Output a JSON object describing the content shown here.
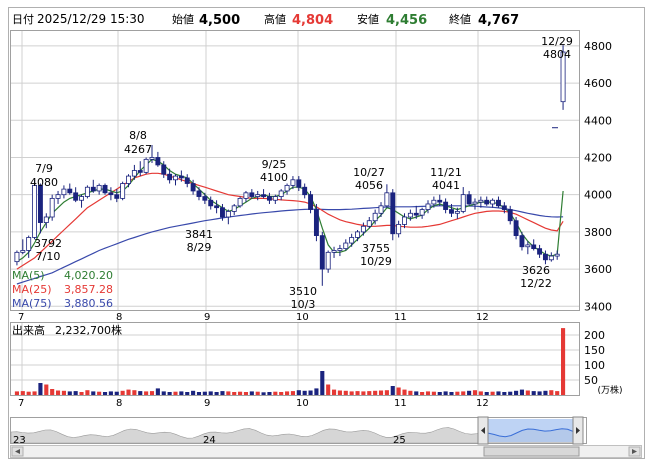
{
  "header": {
    "date_label": "日付",
    "datetime": "2025/12/29 15:30",
    "open_label": "始値",
    "open_value": "4,500",
    "high_label": "高値",
    "high_value": "4,804",
    "low_label": "安値",
    "low_value": "4,456",
    "close_label": "終値",
    "close_value": "4,767"
  },
  "price_axis": {
    "ticks": [
      "4800",
      "4600",
      "4400",
      "4200",
      "4000",
      "3800",
      "3600",
      "3400"
    ]
  },
  "month_labels": [
    "7",
    "8",
    "9",
    "10",
    "11",
    "12"
  ],
  "annotations": [
    {
      "top": "7/9",
      "bottom": "4080"
    },
    {
      "top": "8/8",
      "bottom": "4267"
    },
    {
      "top": "3792",
      "bottom": "7/10"
    },
    {
      "top": "3841",
      "bottom": "8/29"
    },
    {
      "top": "9/25",
      "bottom": "4100"
    },
    {
      "top": "3510",
      "bottom": "10/3"
    },
    {
      "top": "10/27",
      "bottom": "4056"
    },
    {
      "top": "3755",
      "bottom": "10/29"
    },
    {
      "top": "11/21",
      "bottom": "4041"
    },
    {
      "top": "3626",
      "bottom": "12/22"
    },
    {
      "top": "12/29",
      "bottom": "4804"
    }
  ],
  "ma_legend": [
    {
      "label": "MA(5)",
      "value": "4,020.20",
      "color": "#2e7d32"
    },
    {
      "label": "MA(25)",
      "value": "3,857.28",
      "color": "#e53935"
    },
    {
      "label": "MA(75)",
      "value": "3,880.56",
      "color": "#3949ab"
    }
  ],
  "volume": {
    "label": "出来高",
    "value": "2,232,700株",
    "ticks": [
      "200",
      "150",
      "100",
      "50"
    ],
    "unit": "(万株)"
  },
  "navigator": {
    "year_labels": [
      "23",
      "24",
      "25"
    ]
  },
  "colors": {
    "up": "#ffffff",
    "down": "#1a237e",
    "vol_up": "#e53935",
    "vol_down": "#1a237e"
  },
  "chart_data": {
    "type": "candlestick",
    "y_range": [
      3380,
      4880
    ],
    "x_months": [
      "7",
      "8",
      "9",
      "10",
      "11",
      "12"
    ],
    "candles": [
      [
        3640,
        3700,
        3620,
        3690
      ],
      [
        3690,
        3760,
        3680,
        3700
      ],
      [
        3700,
        3780,
        3660,
        3770
      ],
      [
        3770,
        4080,
        3760,
        4050
      ],
      [
        4050,
        4060,
        3792,
        3850
      ],
      [
        3850,
        3900,
        3820,
        3880
      ],
      [
        3880,
        4000,
        3860,
        3980
      ],
      [
        3980,
        4020,
        3950,
        4000
      ],
      [
        4000,
        4050,
        3980,
        4030
      ],
      [
        4030,
        4060,
        4000,
        4010
      ],
      [
        4010,
        4040,
        3960,
        3970
      ],
      [
        3970,
        4000,
        3930,
        3990
      ],
      [
        3990,
        4050,
        3980,
        4040
      ],
      [
        4040,
        4080,
        4010,
        4020
      ],
      [
        4020,
        4060,
        4000,
        4050
      ],
      [
        4050,
        4060,
        4000,
        4010
      ],
      [
        4010,
        4040,
        3970,
        4000
      ],
      [
        4000,
        4030,
        3960,
        3980
      ],
      [
        3980,
        4070,
        3970,
        4060
      ],
      [
        4060,
        4110,
        4040,
        4100
      ],
      [
        4100,
        4160,
        4080,
        4130
      ],
      [
        4130,
        4180,
        4100,
        4120
      ],
      [
        4120,
        4200,
        4110,
        4190
      ],
      [
        4190,
        4267,
        4170,
        4200
      ],
      [
        4200,
        4230,
        4150,
        4160
      ],
      [
        4160,
        4180,
        4090,
        4110
      ],
      [
        4110,
        4140,
        4060,
        4080
      ],
      [
        4080,
        4110,
        4050,
        4100
      ],
      [
        4100,
        4130,
        4070,
        4090
      ],
      [
        4090,
        4110,
        4040,
        4060
      ],
      [
        4060,
        4080,
        4000,
        4020
      ],
      [
        4020,
        4040,
        3970,
        3990
      ],
      [
        3990,
        4010,
        3950,
        3970
      ],
      [
        3970,
        3990,
        3920,
        3940
      ],
      [
        3940,
        3970,
        3900,
        3930
      ],
      [
        3930,
        3950,
        3860,
        3880
      ],
      [
        3880,
        3920,
        3841,
        3910
      ],
      [
        3910,
        3950,
        3890,
        3940
      ],
      [
        3940,
        3990,
        3930,
        3980
      ],
      [
        3980,
        4020,
        3960,
        4010
      ],
      [
        4010,
        4030,
        3980,
        3990
      ],
      [
        3990,
        4020,
        3970,
        4000
      ],
      [
        4000,
        4030,
        3980,
        3990
      ],
      [
        3990,
        4010,
        3950,
        3970
      ],
      [
        3970,
        4000,
        3950,
        3990
      ],
      [
        3990,
        4030,
        3970,
        4020
      ],
      [
        4020,
        4060,
        4000,
        4050
      ],
      [
        4050,
        4100,
        4030,
        4080
      ],
      [
        4080,
        4100,
        4020,
        4040
      ],
      [
        4040,
        4060,
        3980,
        4000
      ],
      [
        4000,
        4020,
        3900,
        3920
      ],
      [
        3920,
        3950,
        3750,
        3780
      ],
      [
        3780,
        3800,
        3510,
        3600
      ],
      [
        3600,
        3700,
        3580,
        3690
      ],
      [
        3690,
        3720,
        3660,
        3700
      ],
      [
        3700,
        3730,
        3670,
        3710
      ],
      [
        3710,
        3760,
        3700,
        3740
      ],
      [
        3740,
        3790,
        3720,
        3770
      ],
      [
        3770,
        3810,
        3750,
        3800
      ],
      [
        3800,
        3850,
        3780,
        3830
      ],
      [
        3830,
        3880,
        3820,
        3860
      ],
      [
        3860,
        3920,
        3840,
        3900
      ],
      [
        3900,
        3960,
        3880,
        3940
      ],
      [
        3940,
        4056,
        3930,
        4010
      ],
      [
        4010,
        4030,
        3755,
        3790
      ],
      [
        3790,
        3860,
        3770,
        3840
      ],
      [
        3840,
        3900,
        3820,
        3880
      ],
      [
        3880,
        3920,
        3860,
        3900
      ],
      [
        3900,
        3940,
        3870,
        3890
      ],
      [
        3890,
        3930,
        3870,
        3920
      ],
      [
        3920,
        3970,
        3900,
        3950
      ],
      [
        3950,
        3990,
        3930,
        3970
      ],
      [
        3970,
        4000,
        3940,
        3960
      ],
      [
        3960,
        3980,
        3900,
        3920
      ],
      [
        3920,
        3950,
        3880,
        3900
      ],
      [
        3900,
        3930,
        3870,
        3910
      ],
      [
        3910,
        4041,
        3900,
        4000
      ],
      [
        4000,
        4020,
        3940,
        3950
      ],
      [
        3950,
        3980,
        3920,
        3960
      ],
      [
        3960,
        3990,
        3930,
        3970
      ],
      [
        3970,
        3990,
        3940,
        3950
      ],
      [
        3950,
        3980,
        3930,
        3970
      ],
      [
        3970,
        3990,
        3930,
        3940
      ],
      [
        3940,
        3960,
        3900,
        3920
      ],
      [
        3920,
        3940,
        3840,
        3860
      ],
      [
        3860,
        3880,
        3760,
        3780
      ],
      [
        3780,
        3800,
        3700,
        3720
      ],
      [
        3720,
        3750,
        3680,
        3730
      ],
      [
        3730,
        3760,
        3700,
        3710
      ],
      [
        3710,
        3730,
        3660,
        3680
      ],
      [
        3680,
        3700,
        3626,
        3650
      ],
      [
        3650,
        3690,
        3640,
        3670
      ],
      [
        3670,
        3700,
        3650,
        3680
      ],
      [
        4500,
        4804,
        4456,
        4767
      ]
    ],
    "ma5": [
      3640,
      3660,
      3690,
      3740,
      3800,
      3850,
      3900,
      3930,
      3960,
      3980,
      3990,
      4000,
      4010,
      4020,
      4030,
      4030,
      4020,
      4010,
      4020,
      4050,
      4090,
      4130,
      4160,
      4190,
      4180,
      4160,
      4130,
      4110,
      4100,
      4090,
      4060,
      4030,
      4000,
      3970,
      3950,
      3930,
      3910,
      3920,
      3940,
      3960,
      3980,
      3990,
      4000,
      3990,
      3990,
      4000,
      4020,
      4040,
      4040,
      4030,
      3990,
      3920,
      3820,
      3730,
      3690,
      3690,
      3700,
      3730,
      3760,
      3790,
      3820,
      3860,
      3890,
      3930,
      3920,
      3900,
      3880,
      3870,
      3880,
      3890,
      3920,
      3940,
      3950,
      3940,
      3930,
      3920,
      3930,
      3940,
      3950,
      3960,
      3960,
      3960,
      3950,
      3930,
      3900,
      3850,
      3790,
      3750,
      3720,
      3700,
      3680,
      3670,
      3680,
      4020
    ],
    "ma25": [
      3600,
      3620,
      3640,
      3660,
      3690,
      3720,
      3750,
      3780,
      3810,
      3840,
      3870,
      3900,
      3930,
      3950,
      3970,
      3990,
      4010,
      4030,
      4050,
      4070,
      4090,
      4100,
      4110,
      4115,
      4115,
      4110,
      4100,
      4090,
      4080,
      4070,
      4060,
      4050,
      4040,
      4030,
      4020,
      4010,
      4000,
      3995,
      3990,
      3985,
      3980,
      3980,
      3980,
      3978,
      3975,
      3972,
      3970,
      3968,
      3965,
      3960,
      3950,
      3935,
      3915,
      3895,
      3880,
      3865,
      3855,
      3848,
      3840,
      3835,
      3830,
      3830,
      3832,
      3835,
      3835,
      3830,
      3828,
      3825,
      3825,
      3826,
      3830,
      3835,
      3840,
      3850,
      3860,
      3870,
      3880,
      3890,
      3900,
      3905,
      3910,
      3912,
      3912,
      3910,
      3905,
      3895,
      3880,
      3865,
      3850,
      3835,
      3820,
      3810,
      3805,
      3857
    ],
    "ma75": [
      3520,
      3530,
      3540,
      3550,
      3560,
      3570,
      3580,
      3595,
      3610,
      3625,
      3640,
      3655,
      3670,
      3685,
      3700,
      3712,
      3724,
      3736,
      3748,
      3760,
      3770,
      3780,
      3790,
      3800,
      3808,
      3816,
      3824,
      3830,
      3836,
      3842,
      3848,
      3854,
      3860,
      3865,
      3870,
      3875,
      3880,
      3884,
      3888,
      3892,
      3896,
      3900,
      3903,
      3906,
      3909,
      3912,
      3915,
      3917,
      3919,
      3921,
      3922,
      3922,
      3921,
      3920,
      3920,
      3920,
      3921,
      3922,
      3924,
      3926,
      3928,
      3930,
      3932,
      3934,
      3935,
      3935,
      3935,
      3935,
      3936,
      3937,
      3938,
      3939,
      3940,
      3940,
      3940,
      3940,
      3940,
      3939,
      3938,
      3936,
      3934,
      3932,
      3929,
      3925,
      3920,
      3914,
      3907,
      3900,
      3894,
      3888,
      3884,
      3881,
      3880,
      3881
    ],
    "volume_manstock": [
      12,
      13,
      11,
      12,
      40,
      35,
      20,
      15,
      14,
      12,
      13,
      10,
      16,
      12,
      11,
      10,
      12,
      11,
      14,
      18,
      16,
      13,
      12,
      13,
      22,
      12,
      10,
      11,
      12,
      10,
      14,
      10,
      11,
      12,
      10,
      13,
      12,
      10,
      11,
      10,
      12,
      11,
      9,
      10,
      11,
      10,
      12,
      13,
      16,
      14,
      15,
      22,
      80,
      35,
      18,
      15,
      14,
      12,
      13,
      12,
      13,
      14,
      15,
      16,
      30,
      25,
      18,
      14,
      12,
      10,
      12,
      11,
      10,
      12,
      10,
      11,
      12,
      14,
      16,
      12,
      10,
      11,
      12,
      10,
      11,
      14,
      18,
      15,
      13,
      12,
      14,
      16,
      13,
      223
    ]
  }
}
